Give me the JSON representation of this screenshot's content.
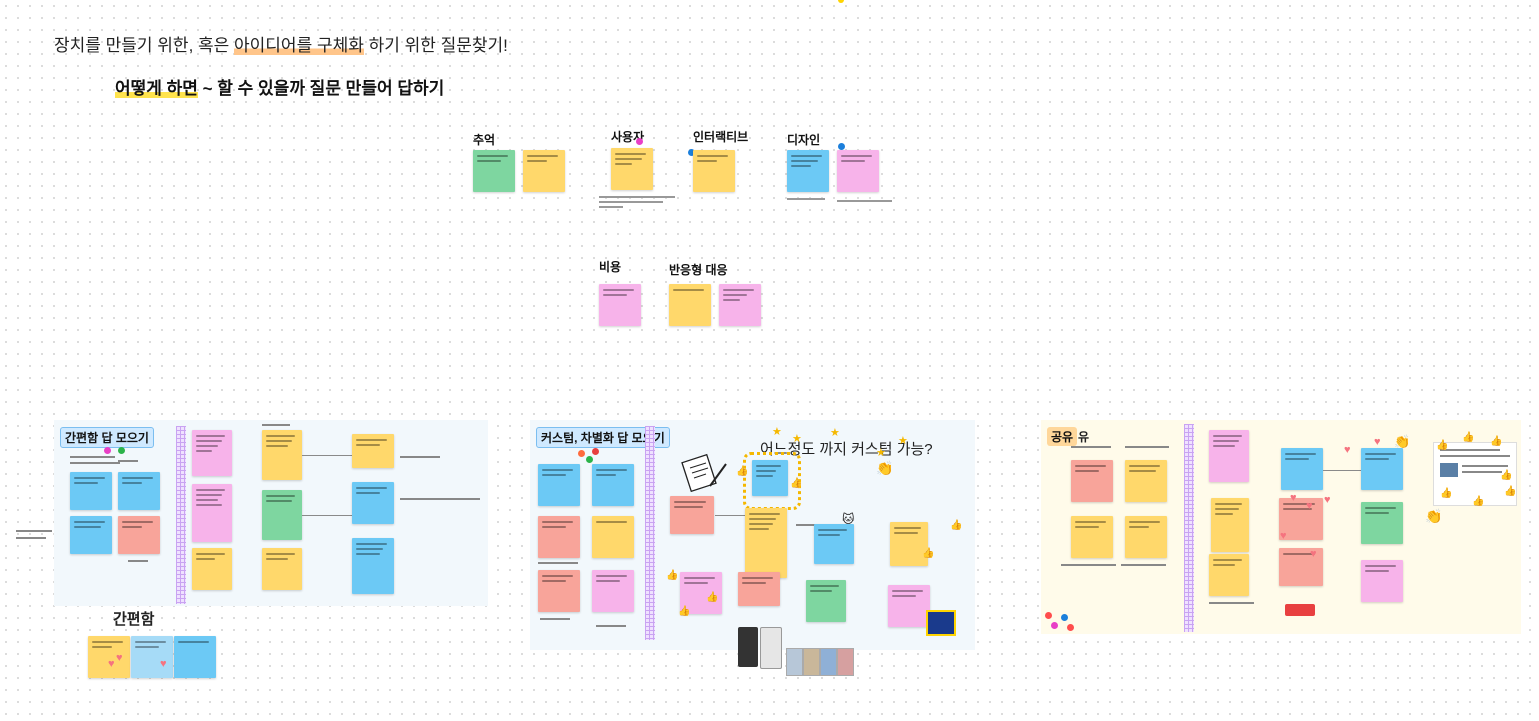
{
  "heading": {
    "main_prefix": "장치를 만들기 위한, 혹은 ",
    "main_highlight": "아이디어를 구체화",
    "main_suffix": " 하기 위한 질문찾기!",
    "sub_highlight": "어떻게 하면",
    "sub_suffix": " ~ 할 수 있을까 질문 만들어 답하기"
  },
  "categories": {
    "memory": "추억",
    "user": "사용자",
    "interactive": "인터랙티브",
    "design": "디자인",
    "cost": "비용",
    "responsive": "반응형 대응"
  },
  "boards": {
    "simple": {
      "title": "간편함 답 모으기",
      "footer_label": "간편함"
    },
    "custom": {
      "title": "커스텀, 차별화 답 모으기",
      "question": "어느정도 까지 커스텀 가능?"
    },
    "share": {
      "title_highlight": "공유",
      "title_rest": "유"
    }
  },
  "colors": {
    "yellow": "#ffd86b",
    "green": "#7ed6a0",
    "blue": "#6cc9f5",
    "pink": "#f7b3ea",
    "salmon": "#f8a49a",
    "board_bg_blue": "#f2f8fc",
    "board_bg_yellow": "#fffbea",
    "title_tag_blue": "#cfe9ff",
    "title_tag_orange": "#ffd79a"
  },
  "icons": [
    "star-icon",
    "thumbs-up-icon",
    "heart-icon",
    "clapping-hands-icon",
    "document-pen-icon",
    "phone-mockup-icon"
  ]
}
